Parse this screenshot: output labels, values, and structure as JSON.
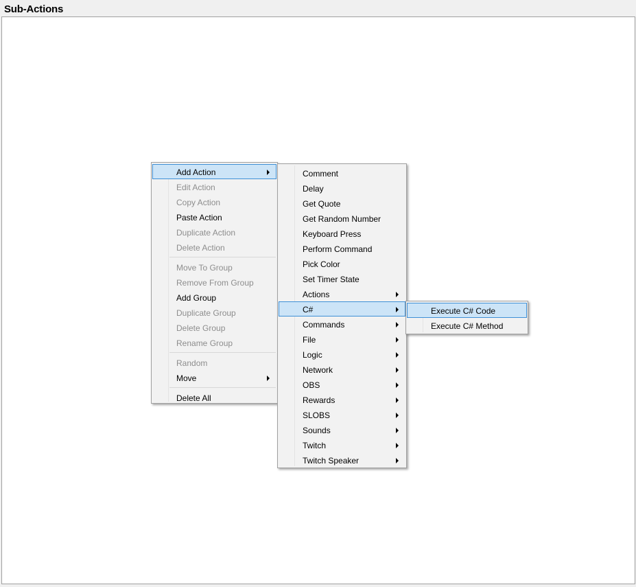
{
  "panel": {
    "title": "Sub-Actions"
  },
  "context_menu": {
    "groups": [
      [
        {
          "label": "Add Action",
          "enabled": true,
          "submenu": true,
          "highlighted": true
        },
        {
          "label": "Edit Action",
          "enabled": false
        },
        {
          "label": "Copy Action",
          "enabled": false
        },
        {
          "label": "Paste Action",
          "enabled": true
        },
        {
          "label": "Duplicate Action",
          "enabled": false
        },
        {
          "label": "Delete Action",
          "enabled": false
        }
      ],
      [
        {
          "label": "Move To Group",
          "enabled": false
        },
        {
          "label": "Remove From Group",
          "enabled": false
        },
        {
          "label": "Add Group",
          "enabled": true
        },
        {
          "label": "Duplicate Group",
          "enabled": false
        },
        {
          "label": "Delete Group",
          "enabled": false
        },
        {
          "label": "Rename Group",
          "enabled": false
        }
      ],
      [
        {
          "label": "Random",
          "enabled": false
        },
        {
          "label": "Move",
          "enabled": true,
          "submenu": true
        }
      ],
      [
        {
          "label": "Delete All",
          "enabled": true
        }
      ]
    ]
  },
  "add_action_menu": {
    "items": [
      {
        "label": "Comment"
      },
      {
        "label": "Delay"
      },
      {
        "label": "Get Quote"
      },
      {
        "label": "Get Random Number"
      },
      {
        "label": "Keyboard Press"
      },
      {
        "label": "Perform Command"
      },
      {
        "label": "Pick Color"
      },
      {
        "label": "Set Timer State"
      },
      {
        "label": "Actions",
        "submenu": true
      },
      {
        "label": "C#",
        "submenu": true,
        "highlighted": true
      },
      {
        "label": "Commands",
        "submenu": true
      },
      {
        "label": "File",
        "submenu": true
      },
      {
        "label": "Logic",
        "submenu": true
      },
      {
        "label": "Network",
        "submenu": true
      },
      {
        "label": "OBS",
        "submenu": true
      },
      {
        "label": "Rewards",
        "submenu": true
      },
      {
        "label": "SLOBS",
        "submenu": true
      },
      {
        "label": "Sounds",
        "submenu": true
      },
      {
        "label": "Twitch",
        "submenu": true
      },
      {
        "label": "Twitch Speaker",
        "submenu": true
      }
    ]
  },
  "csharp_menu": {
    "items": [
      {
        "label": "Execute C# Code",
        "highlighted": true
      },
      {
        "label": "Execute C# Method"
      }
    ]
  },
  "colors": {
    "highlight_bg": "#cce4f7",
    "highlight_border": "#3d8fd6",
    "disabled_text": "#8d8d8d"
  }
}
